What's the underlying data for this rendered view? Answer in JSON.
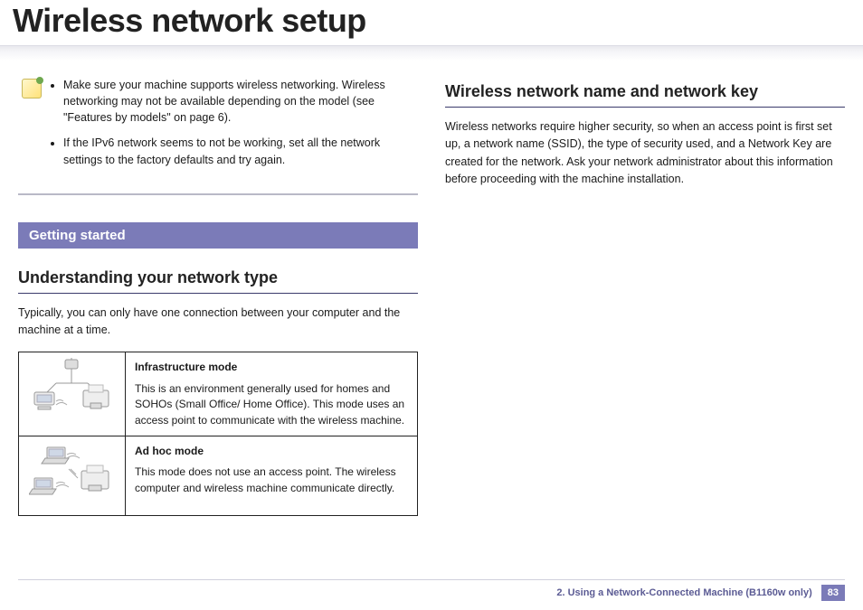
{
  "page_title": "Wireless network setup",
  "note": {
    "items": [
      "Make sure your machine supports wireless networking. Wireless networking may not be available depending on the model (see \"Features by models\" on page 6).",
      "If the IPv6 network seems to not be working, set all the network settings to the factory defaults and try again."
    ]
  },
  "sections": {
    "getting_started_bar": "Getting started",
    "understanding_heading": "Understanding your network type",
    "understanding_intro": "Typically, you can only have one connection between your computer and the machine at a time.",
    "modes": [
      {
        "title": "Infrastructure mode",
        "desc": "This is an environment generally used for homes and SOHOs (Small Office/ Home Office). This mode uses an access point to communicate with the wireless machine."
      },
      {
        "title": "Ad hoc mode",
        "desc": "This mode does not use an access point. The wireless computer and wireless machine communicate directly."
      }
    ],
    "ssid_heading": "Wireless network name and network key",
    "ssid_body": "Wireless networks require higher security, so when an access point is first set up, a network name (SSID), the type of security used, and a Network Key are created for the network. Ask your network administrator about this information before proceeding with the machine installation."
  },
  "footer": {
    "chapter": "2.  Using a Network-Connected Machine (B1160w only)",
    "page_number": "83"
  }
}
